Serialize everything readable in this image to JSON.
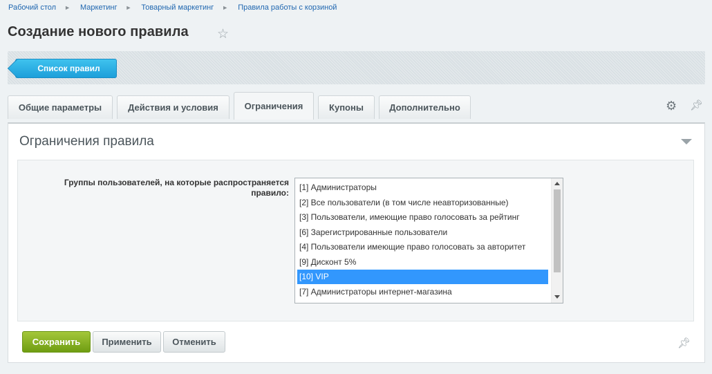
{
  "breadcrumbs": [
    "Рабочий стол",
    "Маркетинг",
    "Товарный маркетинг",
    "Правила работы с корзиной"
  ],
  "page_title": "Создание нового правила",
  "toolbar": {
    "list_button": "Список правил"
  },
  "tabs": [
    {
      "label": "Общие параметры",
      "active": false
    },
    {
      "label": "Действия и условия",
      "active": false
    },
    {
      "label": "Ограничения",
      "active": true
    },
    {
      "label": "Купоны",
      "active": false
    },
    {
      "label": "Дополнительно",
      "active": false
    }
  ],
  "section": {
    "title": "Ограничения правила",
    "field_label": "Группы пользователей, на которые распространяется правило:",
    "options": [
      {
        "label": "[1] Администраторы",
        "selected": false
      },
      {
        "label": "[2] Все пользователи (в том числе неавторизованные)",
        "selected": false
      },
      {
        "label": "[3] Пользователи, имеющие право голосовать за рейтинг",
        "selected": false
      },
      {
        "label": "[6] Зарегистрированные пользователи",
        "selected": false
      },
      {
        "label": "[4] Пользователи имеющие право голосовать за авторитет",
        "selected": false
      },
      {
        "label": "[9] Дисконт 5%",
        "selected": false
      },
      {
        "label": "[10] VIP",
        "selected": true
      },
      {
        "label": "[7] Администраторы интернет-магазина",
        "selected": false
      }
    ]
  },
  "buttons": {
    "save": "Сохранить",
    "apply": "Применить",
    "cancel": "Отменить"
  },
  "icons": {
    "star": "star-outline-icon",
    "gear": "gear-icon",
    "pin": "pin-icon",
    "collapse": "triangle-down-icon",
    "back": "arrow-left-icon"
  },
  "colors": {
    "accent_blue": "#1d9fda",
    "save_green": "#7aa61a",
    "selected_option": "#3297fd",
    "link": "#2067b0",
    "background": "#eef2f4"
  }
}
